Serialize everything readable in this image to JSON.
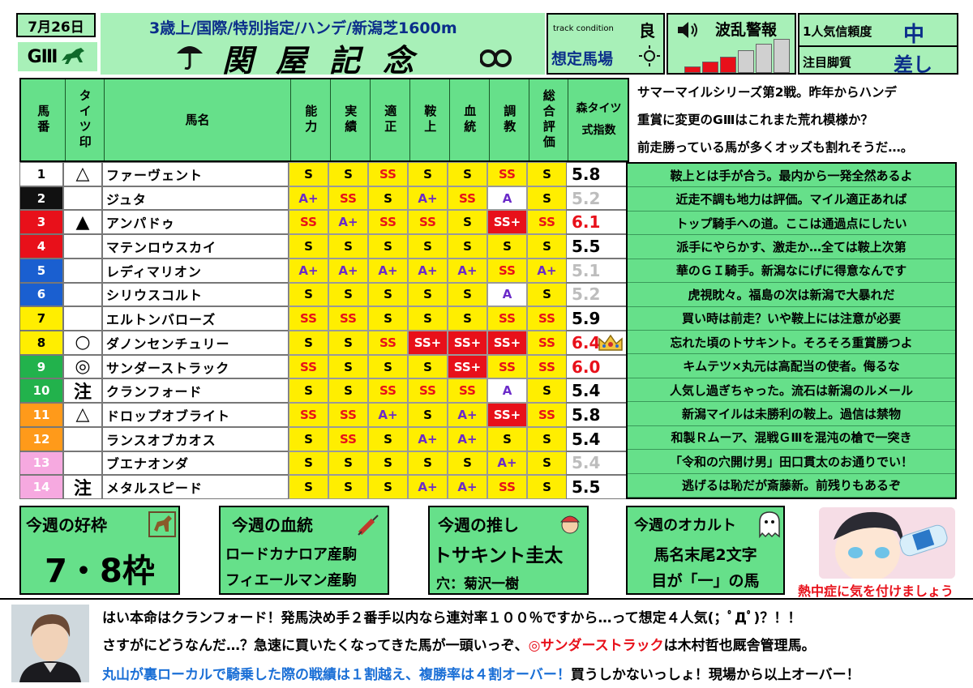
{
  "header": {
    "date": "7月26日",
    "grade_badge": "GⅢ",
    "race_conditions": "3歳上/国際/特別指定/ハンデ/新潟芝1600m",
    "race_name": "関屋記念",
    "track_condition_label": "track condition",
    "track_condition_value": "良",
    "assumed_track_label": "想定馬場",
    "upset_alert_label": "波乱警報",
    "favorite_trust_label": "1人気信頼度",
    "favorite_trust_value": "中",
    "focus_style_label": "注目脚質",
    "focus_style_value": "差し",
    "upset_level": 3
  },
  "columns": {
    "number": "馬番",
    "mark": "タイツ印",
    "name": "馬名",
    "ability": "能力",
    "record": "実績",
    "aptitude": "適正",
    "training_rider": "鞍上",
    "bloodline": "血統",
    "conditioning": "調教",
    "overall": "総合評価",
    "index": "森タイツ式指数"
  },
  "horses": [
    {
      "no": "1",
      "mark": "△",
      "name": "ファーヴェント",
      "grades": [
        "S",
        "S",
        "SS",
        "S",
        "S",
        "SS",
        "S"
      ],
      "index": "5.8",
      "comment": "鞍上とは手が合う。最内から一発全然あるよ"
    },
    {
      "no": "2",
      "mark": "",
      "name": "ジュタ",
      "grades": [
        "A+",
        "SS",
        "S",
        "A+",
        "SS",
        "A",
        "S"
      ],
      "index": "5.2",
      "comment": "近走不調も地力は評価。マイル適正あれば"
    },
    {
      "no": "3",
      "mark": "▲",
      "name": "アンパドゥ",
      "grades": [
        "SS",
        "A+",
        "SS",
        "SS",
        "S",
        "SS+",
        "SS"
      ],
      "index": "6.1",
      "comment": "トップ騎手への道。ここは通過点にしたい"
    },
    {
      "no": "4",
      "mark": "",
      "name": "マテンロウスカイ",
      "grades": [
        "S",
        "S",
        "S",
        "S",
        "S",
        "S",
        "S"
      ],
      "index": "5.5",
      "comment": "派手にやらかす、激走か…全ては鞍上次第"
    },
    {
      "no": "5",
      "mark": "",
      "name": "レディマリオン",
      "grades": [
        "A+",
        "A+",
        "A+",
        "A+",
        "A+",
        "SS",
        "A+"
      ],
      "index": "5.1",
      "comment": "華のＧＩ騎手。新潟なにげに得意なんです"
    },
    {
      "no": "6",
      "mark": "",
      "name": "シリウスコルト",
      "grades": [
        "S",
        "S",
        "S",
        "S",
        "S",
        "A",
        "S"
      ],
      "index": "5.2",
      "comment": "虎視眈々。福島の次は新潟で大暴れだ"
    },
    {
      "no": "7",
      "mark": "",
      "name": "エルトンバローズ",
      "grades": [
        "SS",
        "SS",
        "S",
        "S",
        "S",
        "SS",
        "SS"
      ],
      "index": "5.9",
      "comment": "買い時は前走？いや鞍上には注意が必要"
    },
    {
      "no": "8",
      "mark": "○",
      "name": "ダノンセンチュリー",
      "grades": [
        "S",
        "S",
        "SS",
        "SS+",
        "SS+",
        "SS+",
        "SS"
      ],
      "index": "6.4",
      "comment": "忘れた頃のトサキント。そろそろ重賞勝つよ"
    },
    {
      "no": "9",
      "mark": "◎",
      "name": "サンダーストラック",
      "grades": [
        "SS",
        "S",
        "S",
        "S",
        "SS+",
        "SS",
        "SS"
      ],
      "index": "6.0",
      "comment": "キムテツ×丸元は高配当の使者。侮るな"
    },
    {
      "no": "10",
      "mark": "注",
      "name": "クランフォード",
      "grades": [
        "S",
        "S",
        "SS",
        "SS",
        "SS",
        "A",
        "S"
      ],
      "index": "5.4",
      "comment": "人気し過ぎちゃった。流石は新潟のルメール"
    },
    {
      "no": "11",
      "mark": "△",
      "name": "ドロップオブライト",
      "grades": [
        "SS",
        "SS",
        "A+",
        "S",
        "A+",
        "SS+",
        "SS"
      ],
      "index": "5.8",
      "comment": "新潟マイルは未勝利の鞍上。過信は禁物"
    },
    {
      "no": "12",
      "mark": "",
      "name": "ランスオブカオス",
      "grades": [
        "S",
        "SS",
        "S",
        "A+",
        "A+",
        "S",
        "S"
      ],
      "index": "5.4",
      "comment": "和製Ｒムーア、混戦ＧⅢを混沌の槍で一突き"
    },
    {
      "no": "13",
      "mark": "",
      "name": "ブエナオンダ",
      "grades": [
        "S",
        "S",
        "S",
        "S",
        "S",
        "A+",
        "S"
      ],
      "index": "5.4",
      "comment": "「令和の穴開け男」田口貫太のお通りでい！"
    },
    {
      "no": "14",
      "mark": "注",
      "name": "メタルスピード",
      "grades": [
        "S",
        "S",
        "S",
        "A+",
        "A+",
        "SS",
        "S"
      ],
      "index": "5.5",
      "comment": "逃げるは恥だが斎藤新。前残りもあるぞ"
    }
  ],
  "intro": {
    "line1": "サマーマイルシリーズ第2戦。昨年からハンデ",
    "line2": "重賞に変更のGⅢはこれまた荒れ模様か？",
    "line3": "前走勝っている馬が多くオッズも割れそうだ…。"
  },
  "boxes": {
    "draw_title": "今週の好枠",
    "draw_value": "7・8枠",
    "blood_title": "今週の血統",
    "blood_line1": "ロードカナロア産駒",
    "blood_line2": "フィエールマン産駒",
    "pick_title": "今週の推し",
    "pick_value": "トサキント圭太",
    "pick_sub": "穴：菊沢一樹",
    "occult_title": "今週のオカルト",
    "occult_line1": "馬名末尾2文字",
    "occult_line2": "目が「一」の馬",
    "heat_caption": "熱中症に気を付けましょう"
  },
  "footer": {
    "line1": "はい本命はクランフォード！発馬決め手２番手以内なら連対率１００％ですから…って想定４人気(；ﾟДﾟ)？！！",
    "line2_pre": "さすがにどうなんだ…？急速に買いたくなってきた馬が一頭いっぞ、",
    "line2_hl": "◎サンダーストラック",
    "line2_post": "は木村哲也厩舎管理馬。",
    "line3_hl": "丸山が裏ローカルで騎乗した際の戦績は１割越え、複勝率は４割オーバー！",
    "line3_post": "買うしかないっしょ！現場から以上オーバー！"
  },
  "colors": {
    "frame_green": "#66e08a",
    "grade_yellow": "#ffee00",
    "grade_red": "#e8101a",
    "grade_purple": "#6b2bc9",
    "highlight_blue": "#1a6fd6"
  }
}
